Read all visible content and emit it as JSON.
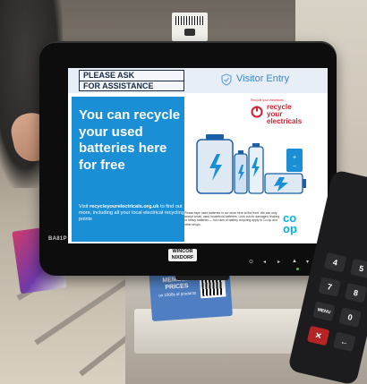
{
  "screen": {
    "header_line1": "PLEASE ASK",
    "header_line2": "FOR ASSISTANCE",
    "visitor_entry": "Visitor Entry",
    "headline": "You can recycle your used batteries here for free",
    "visit_prefix": "Visit ",
    "visit_url": "recycleyourelectricals.org.uk",
    "visit_suffix": " to find out more, including all your local electrical recycling points",
    "logo_small": "Recycle your electricals",
    "logo_line1": "recycle",
    "logo_line2": "your",
    "logo_line3": "electricals",
    "fine_print": "Please tape used batteries in our store here at the front. We can only accept small, used household batteries. Look out for damaged, leaking or heavy batteries — full rules of battery recycling apply to Co-op and other shops.",
    "coop_line1": "co",
    "coop_line2": "op"
  },
  "monitor": {
    "brand": "BA81P",
    "maker_line1": "WINCOR",
    "maker_line2": "NIXDORF",
    "controls": [
      "⊙",
      "◂",
      "▸",
      "▲",
      "▾"
    ]
  },
  "promo": {
    "text_line1": "MEMBER",
    "text_line2": "PRICES",
    "text_line3": "on 1000s of products"
  },
  "terminal": {
    "keys": [
      "4",
      "5",
      "7",
      "8",
      "MENU",
      "0",
      "✕",
      "←"
    ]
  },
  "colors": {
    "screen_blue": "#1b8fd6",
    "recycle_red": "#d12132",
    "coop_blue": "#00b1e7",
    "header_bg": "#e7eef6"
  }
}
